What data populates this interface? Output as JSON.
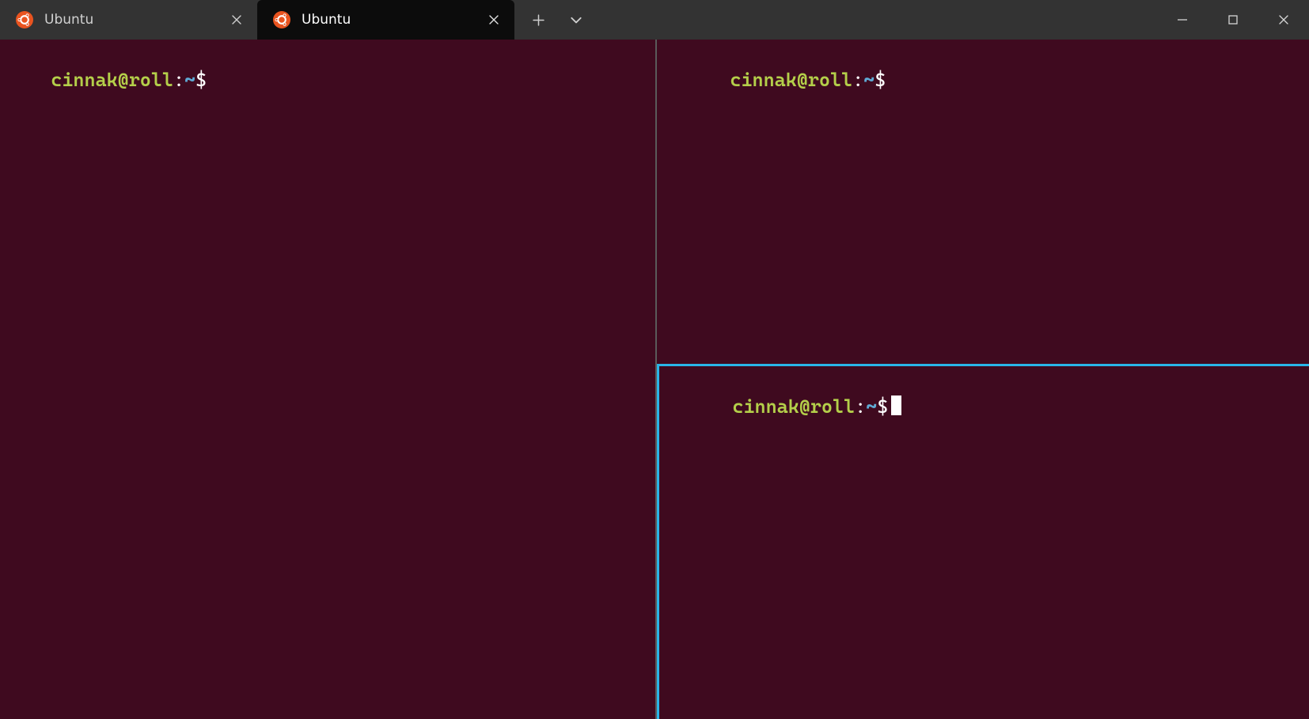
{
  "tabs": [
    {
      "label": "Ubuntu",
      "active": false
    },
    {
      "label": "Ubuntu",
      "active": true
    }
  ],
  "prompt": {
    "user_host": "cinnak@roll",
    "colon": ":",
    "path": "~",
    "dollar": "$"
  },
  "panes": {
    "left": {
      "has_cursor": false
    },
    "top_right": {
      "has_cursor": false
    },
    "bottom_right": {
      "has_cursor": true
    }
  },
  "colors": {
    "terminal_bg": "#3f0a1f",
    "active_border": "#29b5e8",
    "inactive_divider": "#5a5a5a",
    "titlebar_bg": "#333333",
    "active_tab_bg": "#0c0c0c",
    "prompt_user": "#b4cf4a",
    "prompt_path": "#5faad4"
  }
}
